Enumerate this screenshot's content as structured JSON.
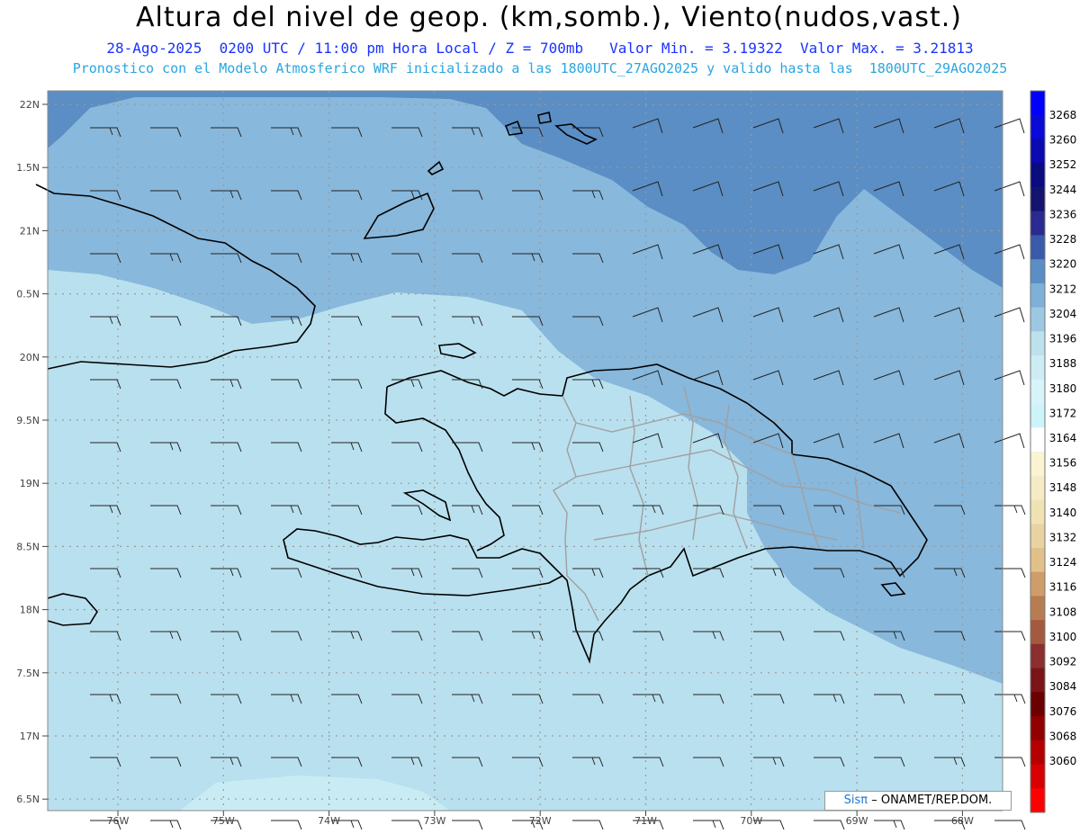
{
  "header": {
    "title": "Altura del nivel de geop. (km,somb.), Viento(nudos,vast.)",
    "date_line": "28-Ago-2025  0200 UTC / 11:00 pm Hora Local / Z = 700mb   Valor Min. = 3.19322  Valor Max. = 3.21813",
    "model_line": "Pronostico con el Modelo Atmosferico WRF inicializado a las 1800UTC_27AGO2025 y valido hasta las  1800UTC_29AGO2025"
  },
  "axes": {
    "lat_labels": [
      "22N",
      "1.5N",
      "21N",
      "0.5N",
      "20N",
      "9.5N",
      "19N",
      "8.5N",
      "18N",
      "7.5N",
      "17N",
      "6.5N"
    ],
    "lon_labels": [
      "76W",
      "75W",
      "74W",
      "73W",
      "72W",
      "71W",
      "70W",
      "69W",
      "68W"
    ]
  },
  "colorbar": {
    "labels": [
      "3268",
      "3260",
      "3252",
      "3244",
      "3236",
      "3228",
      "3220",
      "3212",
      "3204",
      "3196",
      "3188",
      "3180",
      "3172",
      "3164",
      "3156",
      "3148",
      "3140",
      "3132",
      "3124",
      "3116",
      "3108",
      "3100",
      "3092",
      "3084",
      "3076",
      "3068",
      "3060"
    ],
    "colors": [
      "#0000ff",
      "#0a0ad8",
      "#0a0ab0",
      "#0b0b80",
      "#141470",
      "#2a2a90",
      "#3a5aaa",
      "#5b8ec4",
      "#7fb0d8",
      "#9cc8e2",
      "#bde2ee",
      "#cdecf4",
      "#d8f4f8",
      "#cdf4f8",
      "#ffffff",
      "#faf4d2",
      "#f5ebc4",
      "#f1e2b4",
      "#ead3a2",
      "#e2c08a",
      "#cf9d6a",
      "#b77c52",
      "#a45a3e",
      "#8a2e2e",
      "#7a1418",
      "#6a0000",
      "#900000",
      "#b40000",
      "#d80000",
      "#ff0000"
    ]
  },
  "field_colors": {
    "high": "#5b8ec4",
    "mid": "#88b8dc",
    "low": "#b9e0ee",
    "lowest": "#c9ecf4"
  },
  "credit": {
    "sis": "Sisπ",
    "org": "– ONAMET/REP.DOM."
  }
}
